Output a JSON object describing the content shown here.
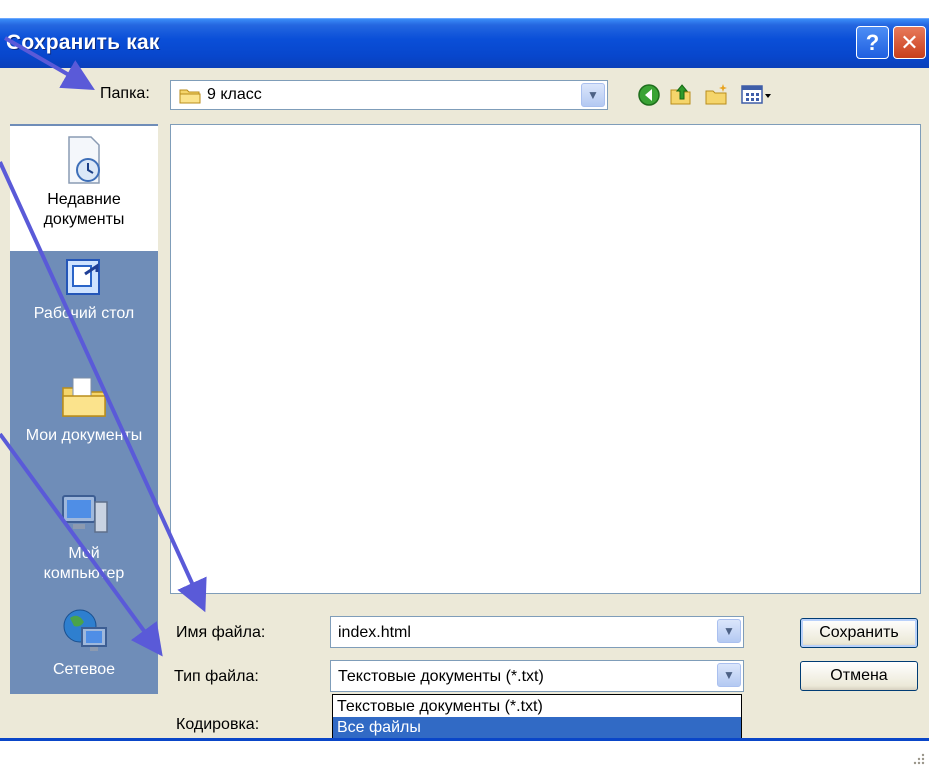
{
  "window": {
    "title": "Сохранить как",
    "help_button": "?",
    "close_button": "✕"
  },
  "toolbar": {
    "folder_label": "Папка:",
    "folder_value": "9 класс",
    "icons": [
      "back-icon",
      "up-folder-icon",
      "new-folder-icon",
      "views-menu-icon"
    ]
  },
  "places": [
    {
      "label": "Недавние документы",
      "icon": "recent-documents-icon"
    },
    {
      "label": "Рабочий стол",
      "icon": "desktop-icon"
    },
    {
      "label": "Мои документы",
      "icon": "my-documents-icon"
    },
    {
      "label": "Мой компьютер",
      "icon": "my-computer-icon"
    },
    {
      "label": "Сетевое",
      "icon": "network-icon"
    }
  ],
  "form": {
    "filename_label": "Имя файла:",
    "filename_value": "index.html",
    "filetype_label": "Тип файла:",
    "filetype_value": "Текстовые документы (*.txt)",
    "encoding_label": "Кодировка:",
    "filetype_options": [
      "Текстовые документы (*.txt)",
      "Все файлы"
    ],
    "selected_option": "Все файлы"
  },
  "buttons": {
    "save": "Сохранить",
    "cancel": "Отмена"
  },
  "colors": {
    "title_bar": "#0a4fd8",
    "dialog_bg": "#ece9d8",
    "places_bar": "#6f8db8",
    "annotation_arrow": "#5a5ad8",
    "selection": "#316ac5"
  }
}
